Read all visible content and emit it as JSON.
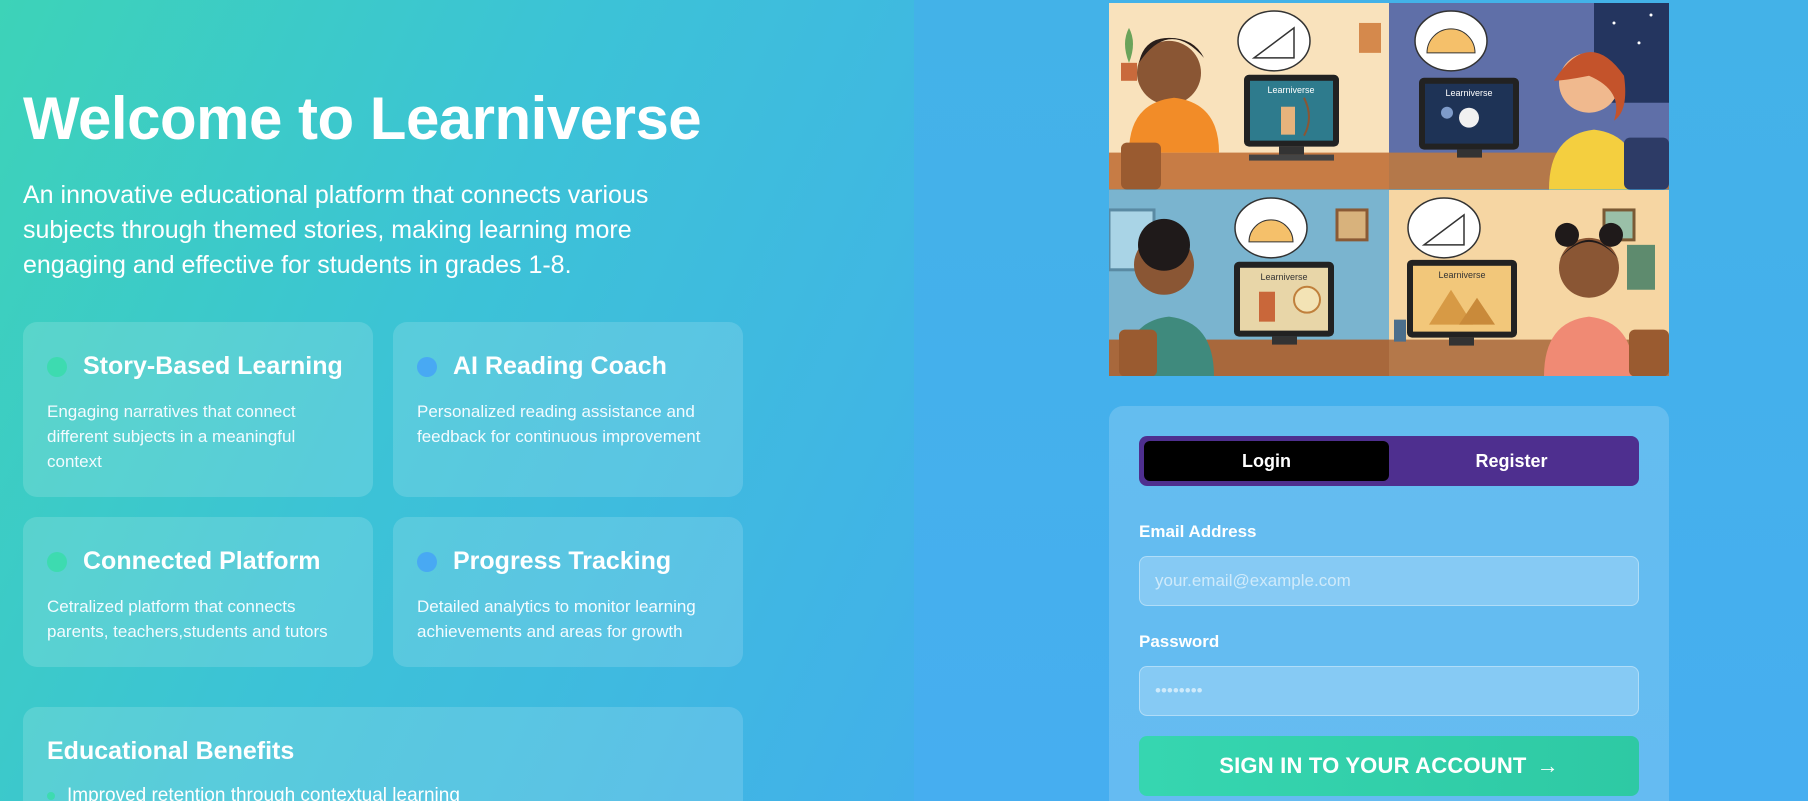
{
  "hero": {
    "title": "Welcome to Learniverse",
    "description": "An innovative educational platform that connects various subjects through themed stories, making learning more engaging and effective for students in grades 1-8."
  },
  "features": [
    {
      "title": "Story-Based Learning",
      "text": "Engaging narratives that connect different subjects in a meaningful context",
      "dot_color": "#3ddbb0"
    },
    {
      "title": "AI Reading Coach",
      "text": "Personalized reading assistance and feedback for continuous improvement",
      "dot_color": "#48a9f3"
    },
    {
      "title": "Connected Platform",
      "text": "Cetralized platform that connects parents, teachers,students and tutors",
      "dot_color": "#3ddbb0"
    },
    {
      "title": "Progress Tracking",
      "text": "Detailed analytics to monitor learning achievements and areas for growth",
      "dot_color": "#48a9f3"
    }
  ],
  "benefits": {
    "title": "Educational Benefits",
    "items": [
      "Improved retention through contextual learning"
    ]
  },
  "illustration": {
    "screen_label": "Learniverse",
    "scenes": [
      "archer-lesson",
      "astronaut-lesson",
      "ship-compass-lesson",
      "pyramids-lesson"
    ]
  },
  "auth": {
    "tabs": {
      "login": "Login",
      "register": "Register",
      "active": "login"
    },
    "email": {
      "label": "Email Address",
      "placeholder": "your.email@example.com",
      "value": ""
    },
    "password": {
      "label": "Password",
      "placeholder": "••••••••",
      "value": ""
    },
    "submit_label": "SIGN IN TO YOUR ACCOUNT",
    "submit_icon": "arrow-right-icon"
  },
  "colors": {
    "accent_green": "#3ddbb0",
    "accent_blue": "#48a9f3",
    "tab_bar": "#4e2f8f",
    "tab_active": "#000000",
    "button": "#36d6b0"
  }
}
